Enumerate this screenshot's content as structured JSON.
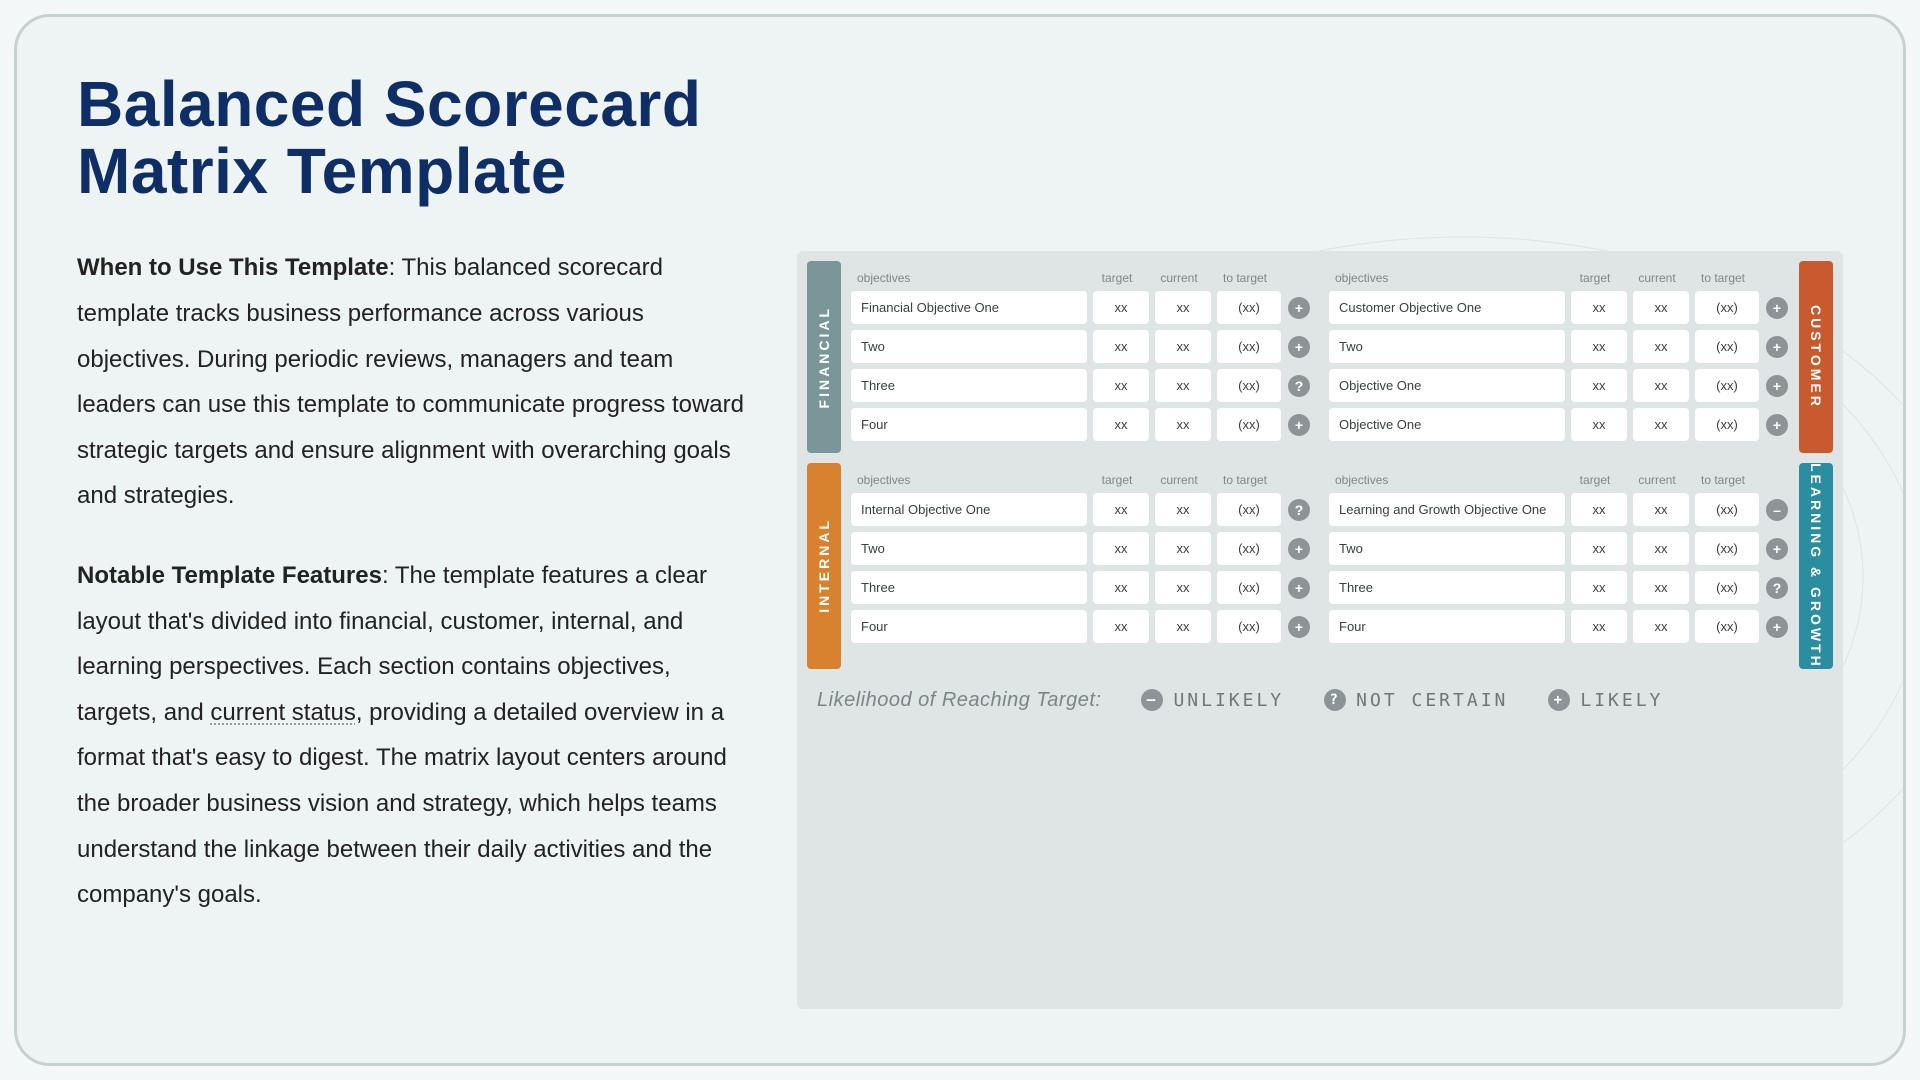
{
  "title": "Balanced Scorecard Matrix Template",
  "p1_label": "When to Use This Template",
  "p1_body": ": This balanced scorecard template tracks business performance across various objectives. During periodic reviews, managers and team leaders can use this template to communicate progress toward strategic targets and ensure alignment with overarching goals and strategies.",
  "p2_label": "Notable Template Features",
  "p2_body_a": ": The template features a clear layout that's divided into financial, customer, internal, and learning perspectives. Each section contains objectives, targets, and ",
  "p2_underlined": "current status",
  "p2_body_b": ", providing a detailed overview in a format that's easy to digest. The matrix layout centers around the broader business vision and strategy, which helps teams understand the linkage between their daily activities and the company's goals.",
  "headers": {
    "objectives": "objectives",
    "target": "target",
    "current": "current",
    "to_target": "to target"
  },
  "placeholders": {
    "xx": "xx",
    "pxx": "(xx)"
  },
  "status_glyph": {
    "plus": "+",
    "question": "?",
    "minus": "–"
  },
  "quadrants": {
    "financial": {
      "label": "FINANCIAL",
      "rows": [
        {
          "name": "Financial Objective One",
          "status": "plus"
        },
        {
          "name": "Two",
          "status": "plus"
        },
        {
          "name": "Three",
          "status": "question"
        },
        {
          "name": "Four",
          "status": "plus"
        }
      ]
    },
    "customer": {
      "label": "CUSTOMER",
      "rows": [
        {
          "name": "Customer Objective One",
          "status": "plus"
        },
        {
          "name": "Two",
          "status": "plus"
        },
        {
          "name": "Objective One",
          "status": "plus"
        },
        {
          "name": "Objective One",
          "status": "plus"
        }
      ]
    },
    "internal": {
      "label": "INTERNAL",
      "rows": [
        {
          "name": "Internal Objective One",
          "status": "question"
        },
        {
          "name": "Two",
          "status": "plus"
        },
        {
          "name": "Three",
          "status": "plus"
        },
        {
          "name": "Four",
          "status": "plus"
        }
      ]
    },
    "growth": {
      "label": "LEARNING & GROWTH",
      "rows": [
        {
          "name": "Learning and Growth Objective One",
          "status": "minus"
        },
        {
          "name": "Two",
          "status": "plus"
        },
        {
          "name": "Three",
          "status": "question"
        },
        {
          "name": "Four",
          "status": "plus"
        }
      ]
    }
  },
  "legend": {
    "lead": "Likelihood of Reaching Target:",
    "unlikely": "UNLIKELY",
    "not_certain": "NOT CERTAIN",
    "likely": "LIKELY"
  }
}
